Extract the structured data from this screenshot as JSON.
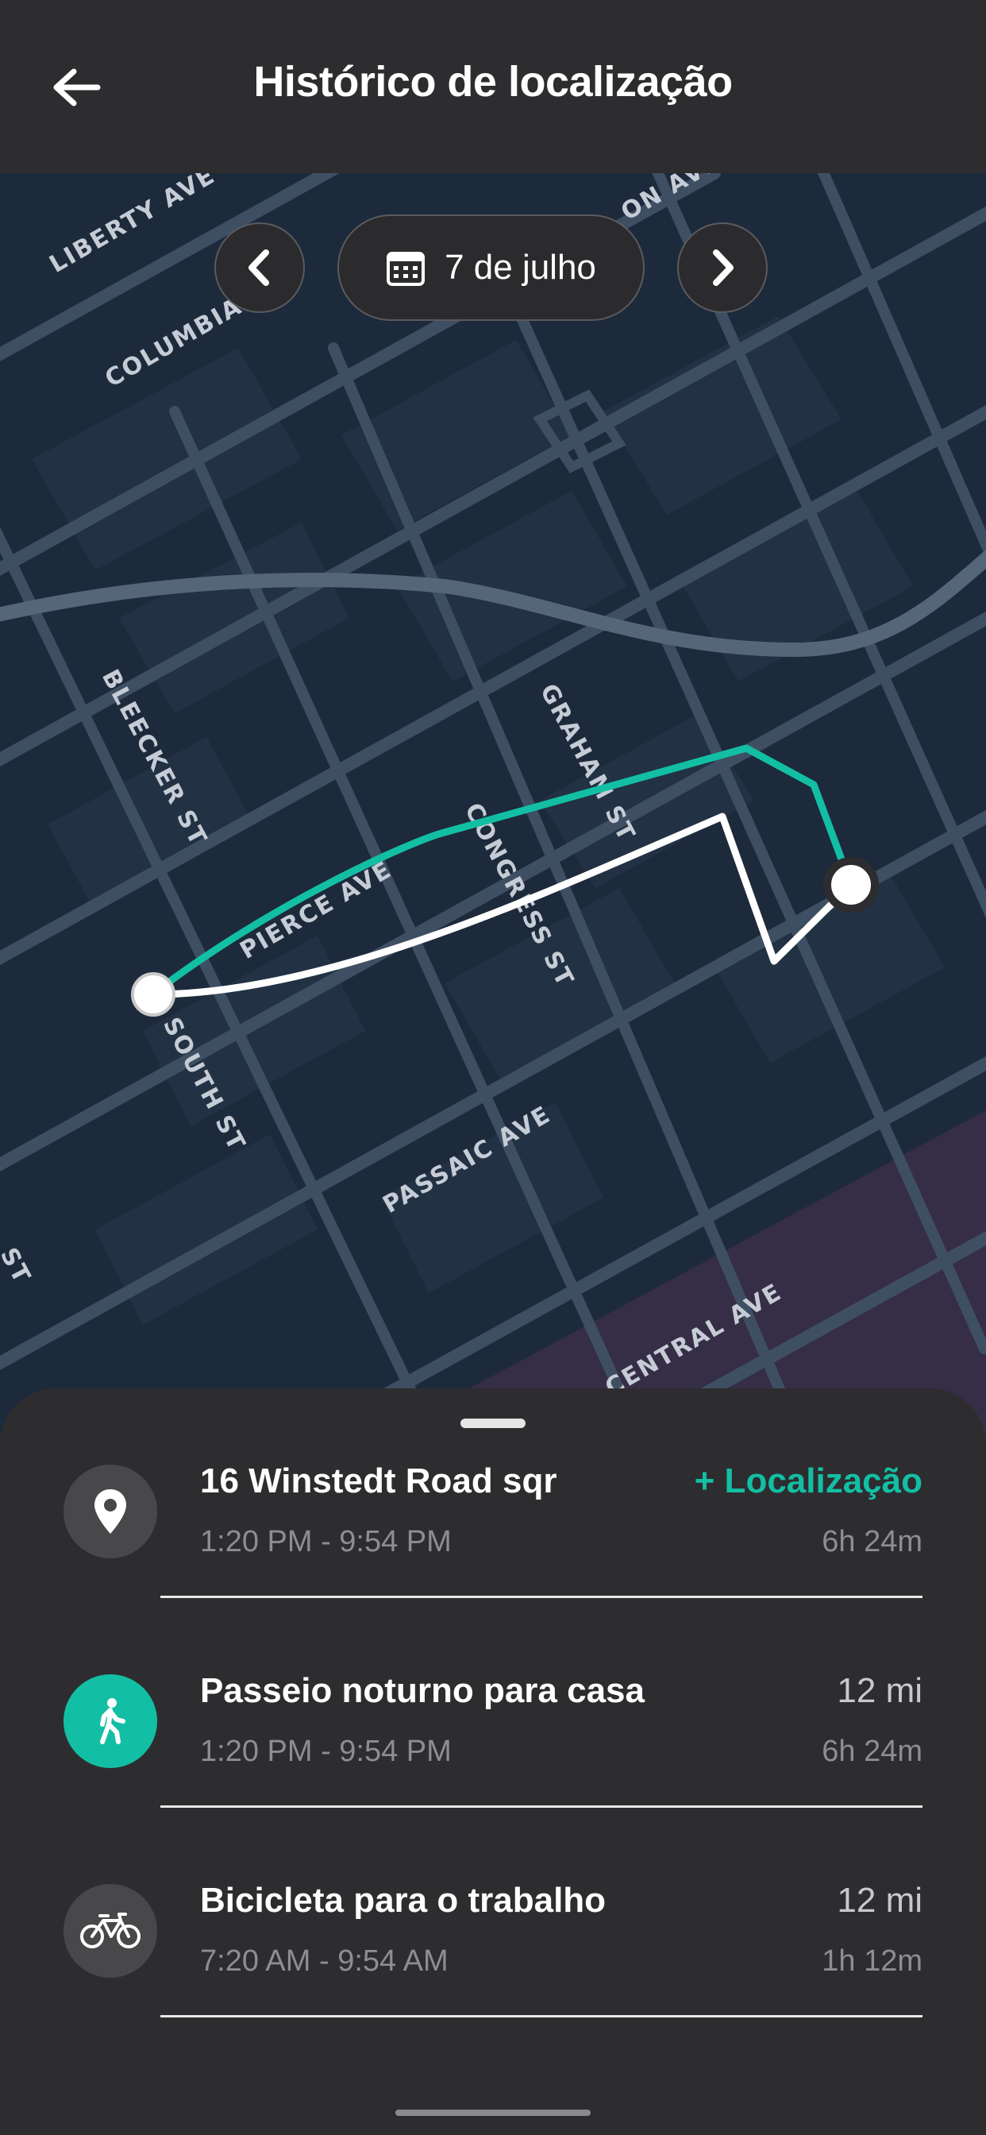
{
  "header": {
    "title": "Histórico de localização",
    "back_icon": "arrow-left-icon"
  },
  "date_nav": {
    "date_label": "7 de julho",
    "prev_icon": "chevron-left-icon",
    "next_icon": "chevron-right-icon",
    "calendar_icon": "calendar-icon"
  },
  "map": {
    "streets": [
      "LIBERTY AVE",
      "COLUMBIA",
      "ON AVE",
      "BLEECKER ST",
      "GRAHAM ST",
      "CONGRESS ST",
      "PIERCE AVE",
      "SOUTH ST",
      "PASSAIC AVE",
      "CENTRAL AVE",
      "ST"
    ],
    "route_colors": {
      "primary": "#13bfa4",
      "secondary": "#ffffff"
    }
  },
  "timeline": [
    {
      "icon": "location-pin-icon",
      "title": "16 Winstedt Road sqr",
      "time": "1:20 PM - 9:54 PM",
      "right_top": "+ Localização",
      "right_bottom": "6h 24m"
    },
    {
      "icon": "walking-person-icon",
      "title": "Passeio noturno para casa",
      "time": "1:20 PM - 9:54 PM",
      "right_top": "12 mi",
      "right_bottom": "6h 24m"
    },
    {
      "icon": "bicycle-icon",
      "title": "Bicicleta para o trabalho",
      "time": "7:20 AM - 9:54 AM",
      "right_top": "12 mi",
      "right_bottom": "1h 12m"
    }
  ],
  "colors": {
    "accent": "#13bfa4",
    "background": "#2d2d2f",
    "map_background": "#1d2a3b"
  }
}
